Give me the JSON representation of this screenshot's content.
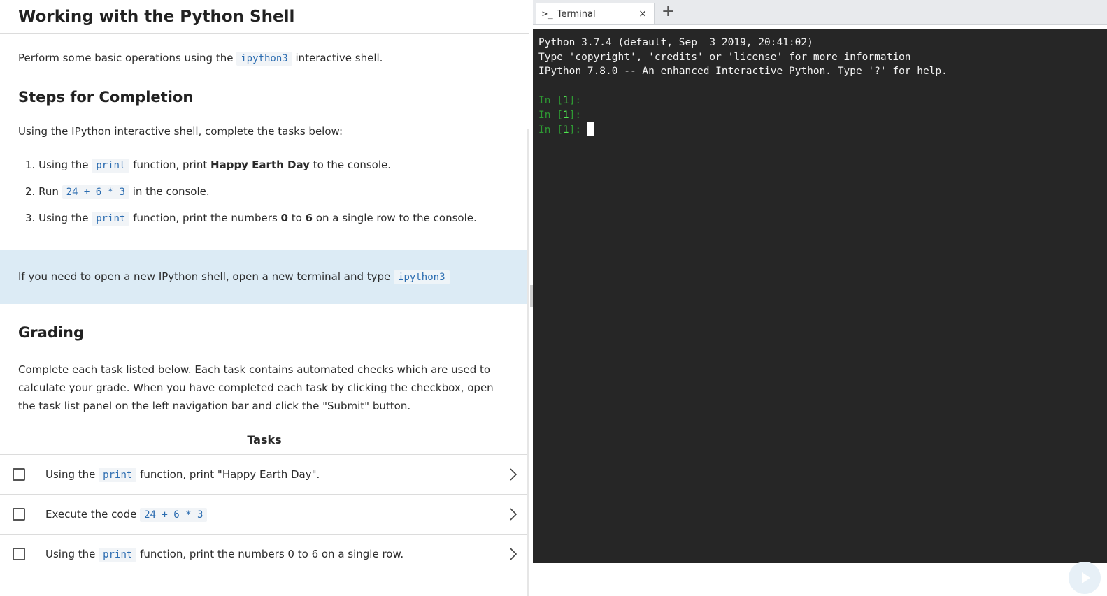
{
  "page": {
    "title": "Working with the Python Shell",
    "intro_prefix": "Perform some basic operations using the",
    "intro_code": "ipython3",
    "intro_suffix": "interactive shell."
  },
  "steps": {
    "heading": "Steps for Completion",
    "subtitle": "Using the IPython interactive shell, complete the tasks below:",
    "items": [
      {
        "num": "1.",
        "a": "Using the",
        "code": "print",
        "b": "function, print",
        "bold": "Happy Earth Day",
        "c": "to the console."
      },
      {
        "num": "2.",
        "a": "Run",
        "code": "24 + 6 * 3",
        "b": "in the console."
      },
      {
        "num": "3.",
        "a": "Using the",
        "code": "print",
        "b": "function, print the numbers",
        "bold1": "0",
        "mid": "to",
        "bold2": "6",
        "c": "on a single row to the console."
      }
    ]
  },
  "note": {
    "text": "If you need to open a new IPython shell, open a new terminal and type",
    "code": "ipython3"
  },
  "grading": {
    "heading": "Grading",
    "text": "Complete each task listed below. Each task contains automated checks which are used to calculate your grade. When you have completed each task by clicking the checkbox, open the task list panel on the left navigation bar and click the \"Submit\" button."
  },
  "tasks": {
    "header": "Tasks",
    "rows": [
      {
        "a": "Using the",
        "code": "print",
        "b": "function, print \"Happy Earth Day\"."
      },
      {
        "a": "Execute the code",
        "code": "24 + 6 * 3",
        "b": ""
      },
      {
        "a": "Using the",
        "code": "print",
        "b": "function, print the numbers 0 to 6 on a single row."
      }
    ]
  },
  "terminal": {
    "tab_icon": ">_",
    "tab_label": "Terminal",
    "close_glyph": "×",
    "add_glyph": "+",
    "lines": [
      "Python 3.7.4 (default, Sep  3 2019, 20:41:02)",
      "Type 'copyright', 'credits' or 'license' for more information",
      "IPython 7.8.0 -- An enhanced Interactive Python. Type '?' for help."
    ],
    "prompt_in": "In [",
    "prompt_num": "1",
    "prompt_close": "]: "
  },
  "colors": {
    "code_text": "#2b6cb0",
    "note_bg": "#dcebf5",
    "terminal_bg": "#262626",
    "prompt_green": "#2e9a33"
  },
  "icons": [
    "terminal-icon",
    "close-icon",
    "plus-icon",
    "chevron-right-icon",
    "play-icon"
  ]
}
